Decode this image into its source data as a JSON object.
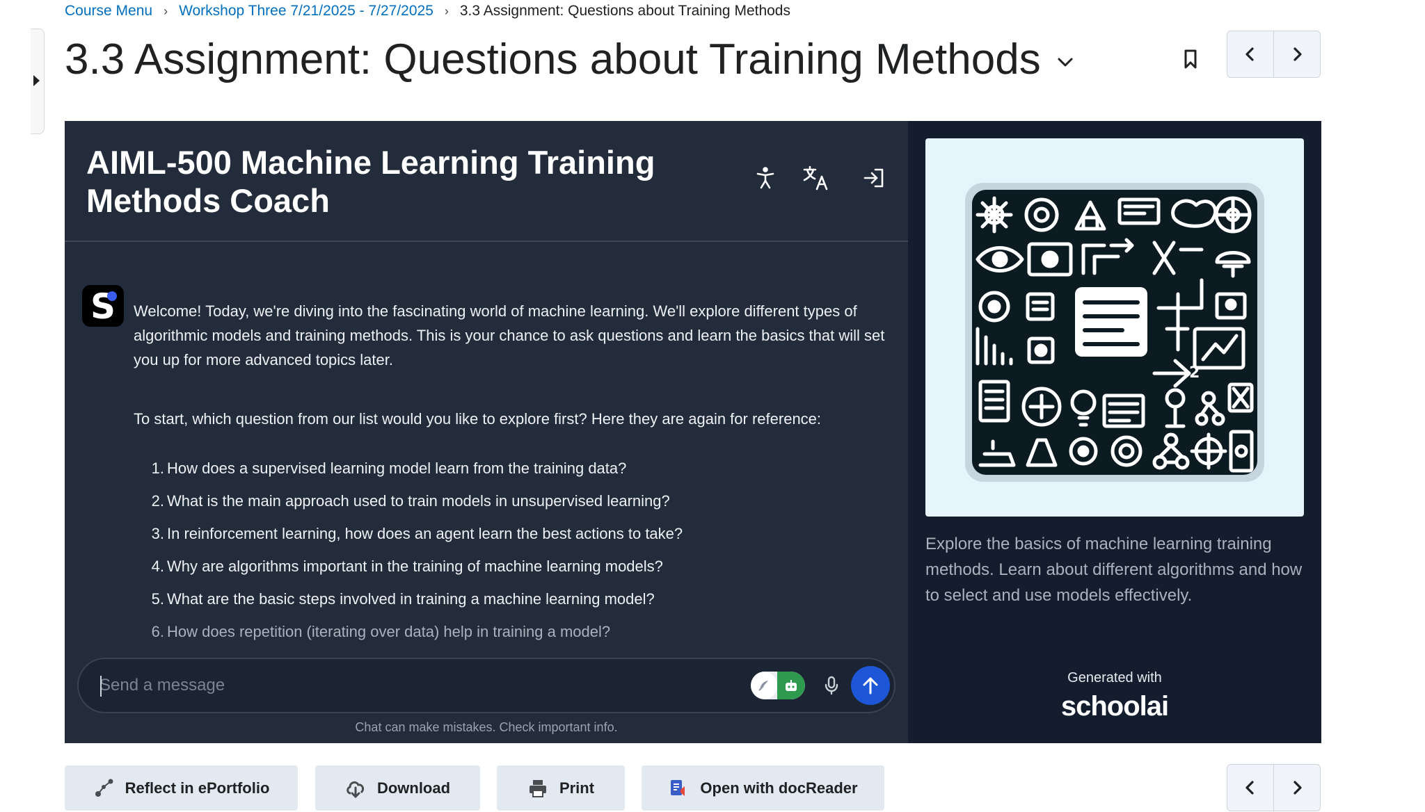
{
  "breadcrumb": {
    "items": [
      "Course Menu",
      "Workshop Three 7/21/2025 - 7/27/2025"
    ],
    "current": "3.3 Assignment: Questions about Training Methods"
  },
  "page": {
    "title": "3.3 Assignment: Questions about Training Methods"
  },
  "chat": {
    "title": "AIML-500 Machine Learning Training Methods Coach",
    "intro": "Welcome! Today, we're diving into the fascinating world of machine learning. We'll explore different types of algorithmic models and training methods. This is your chance to ask questions and learn the basics that will set you up for more advanced topics later.",
    "prompt": "To start, which question from our list would you like to explore first? Here they are again for reference:",
    "questions": [
      {
        "num": "1.",
        "text": "How does a supervised learning model learn from the training data?"
      },
      {
        "num": "2.",
        "text": "What is the main approach used to train models in unsupervised learning?"
      },
      {
        "num": "3.",
        "text": "In reinforcement learning, how does an agent learn the best actions to take?"
      },
      {
        "num": "4.",
        "text": "Why are algorithms important in the training of machine learning models?"
      },
      {
        "num": "5.",
        "text": "What are the basic steps involved in training a machine learning model?"
      },
      {
        "num": "6.",
        "text": "How does repetition (iterating over data) help in training a model?"
      }
    ],
    "input_placeholder": "Send a message",
    "disclaimer": "Chat can make mistakes. Check important info."
  },
  "info": {
    "description": "Explore the basics of machine learning training methods. Learn about different algorithms and how to select and use models effectively.",
    "generated_with": "Generated with",
    "brand": "schoolai"
  },
  "actions": {
    "reflect": "Reflect in ePortfolio",
    "download": "Download",
    "print": "Print",
    "docreader": "Open with docReader"
  },
  "colors": {
    "link": "#006fbf",
    "chat_bg": "#232c3a",
    "info_bg": "#141d2d",
    "send_button": "#1d57d8",
    "toggle_active": "#2e9a4e",
    "button_bg": "#e3e9f1"
  }
}
